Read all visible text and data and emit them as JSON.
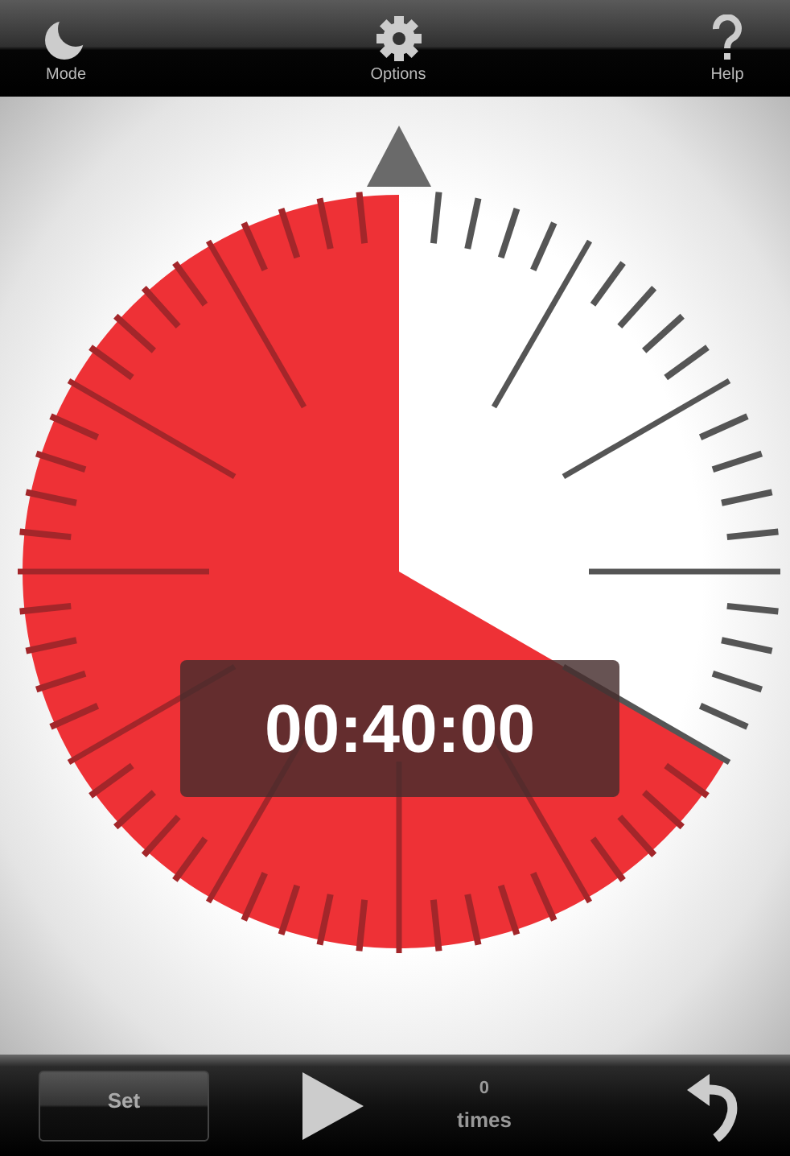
{
  "toolbar": [
    {
      "kind": "moon",
      "label": "Mode"
    },
    {
      "kind": "gear",
      "label": "Options"
    },
    {
      "kind": "help",
      "label": "Help"
    }
  ],
  "timer": {
    "display": "00:40:00"
  },
  "bottom_bar": {
    "set_button": "Set",
    "count": "0",
    "count_label": "times"
  }
}
